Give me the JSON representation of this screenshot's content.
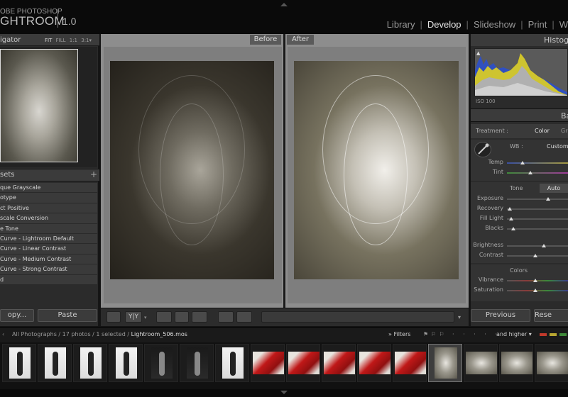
{
  "brand": {
    "line1": "OBE PHOTOSHOP",
    "line2": "GHTROOM",
    "version": "1.0"
  },
  "modules": [
    "Library",
    "Develop",
    "Slideshow",
    "Print",
    "W"
  ],
  "active_module": "Develop",
  "navigator": {
    "title": "igator",
    "zoom_options": [
      "FIT",
      "FILL",
      "1:1",
      "3:1"
    ],
    "zoom_selected": "FIT",
    "zoom_arrow": "▾"
  },
  "presets": {
    "title": "sets",
    "add": "+",
    "items": [
      "que Grayscale",
      "otype",
      "ct Positive",
      "scale Conversion",
      "e Tone",
      "Curve - Lightroom Default",
      "Curve - Linear Contrast",
      "Curve - Medium Contrast",
      "Curve - Strong Contrast",
      "d"
    ]
  },
  "left_buttons": {
    "copy": "opy...",
    "paste": "Paste"
  },
  "compare": {
    "before": "Before",
    "after": "After"
  },
  "toolbar": {
    "yy": "Y|Y",
    "yy_arrow": "▾",
    "menu_arrow": "▾"
  },
  "histogram": {
    "title": "Histogr",
    "iso": "ISO 100",
    "clip_marker": "▲"
  },
  "basic": {
    "title": "Ba",
    "treatment_label": "Treatment :",
    "treatment_color": "Color",
    "treatment_gray": "Gr",
    "wb_label": "WB :",
    "wb_value": "Custom",
    "tone_label": "Tone",
    "auto": "Auto",
    "colors_label": "Colors",
    "sliders": [
      {
        "label": "Temp",
        "value": 0.25,
        "group": "wb"
      },
      {
        "label": "Tint",
        "value": 0.38,
        "group": "wb"
      },
      {
        "label": "Exposure",
        "value": 0.68,
        "group": "tone"
      },
      {
        "label": "Recovery",
        "value": 0.05,
        "group": "tone"
      },
      {
        "label": "Fill Light",
        "value": 0.07,
        "group": "tone"
      },
      {
        "label": "Blacks",
        "value": 0.1,
        "group": "tone"
      },
      {
        "label": "Brightness",
        "value": 0.6,
        "group": "tone"
      },
      {
        "label": "Contrast",
        "value": 0.47,
        "group": "tone"
      },
      {
        "label": "Vibrance",
        "value": 0.47,
        "group": "colors"
      },
      {
        "label": "Saturation",
        "value": 0.47,
        "group": "colors"
      }
    ]
  },
  "right_buttons": {
    "previous": "Previous",
    "reset": "Rese"
  },
  "filmstrip_bar": {
    "nav": "‹",
    "path_prefix": "All Photographs / 17 photos / 1 selected /",
    "path_file": "Lightroom_506.mos",
    "filters_prefix": "»",
    "filters": "Filters",
    "dots": "· · · · ·",
    "and_higher": "and higher ▾",
    "color_labels": [
      "#c0392b",
      "#b8a631",
      "#3f8a3a",
      "#3a5fa8"
    ]
  },
  "filmstrip": {
    "thumbs": [
      {
        "kind": "bw-white"
      },
      {
        "kind": "bw-white"
      },
      {
        "kind": "bw-white"
      },
      {
        "kind": "bw-white"
      },
      {
        "kind": "bw-black"
      },
      {
        "kind": "bw-black"
      },
      {
        "kind": "bw-white"
      },
      {
        "kind": "red"
      },
      {
        "kind": "red"
      },
      {
        "kind": "red"
      },
      {
        "kind": "red"
      },
      {
        "kind": "red"
      },
      {
        "kind": "veil",
        "selected": true
      },
      {
        "kind": "veil"
      },
      {
        "kind": "veil"
      },
      {
        "kind": "veil"
      },
      {
        "kind": "veil"
      }
    ]
  }
}
